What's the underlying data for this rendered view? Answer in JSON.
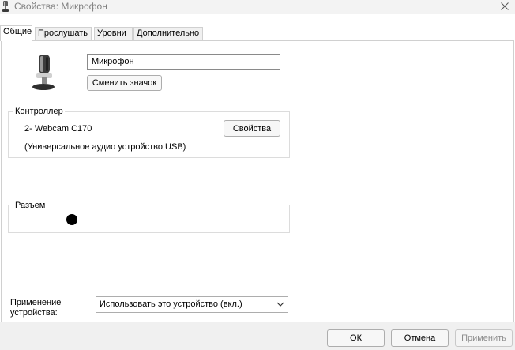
{
  "window": {
    "title": "Свойства: Микрофон",
    "icon": "microphone-icon",
    "close_icon": "close-icon"
  },
  "tabs": [
    {
      "label": "Общие",
      "active": true
    },
    {
      "label": "Прослушать",
      "active": false
    },
    {
      "label": "Уровни",
      "active": false
    },
    {
      "label": "Дополнительно",
      "active": false
    }
  ],
  "general": {
    "device_icon": "microphone-icon",
    "device_name": "Микрофон",
    "change_icon_label": "Сменить значок",
    "controller": {
      "group_label": "Контроллер",
      "name": "2- Webcam C170",
      "properties_label": "Свойства",
      "description": "(Универсальное аудио устройство USB)"
    },
    "jack": {
      "group_label": "Разъем",
      "color": "#000000"
    },
    "device_usage": {
      "label_line1": "Применение",
      "label_line2": "устройства:",
      "selected": "Использовать это устройство (вкл.)"
    }
  },
  "footer": {
    "ok_label": "ОК",
    "cancel_label": "Отмена",
    "apply_label": "Применить"
  }
}
